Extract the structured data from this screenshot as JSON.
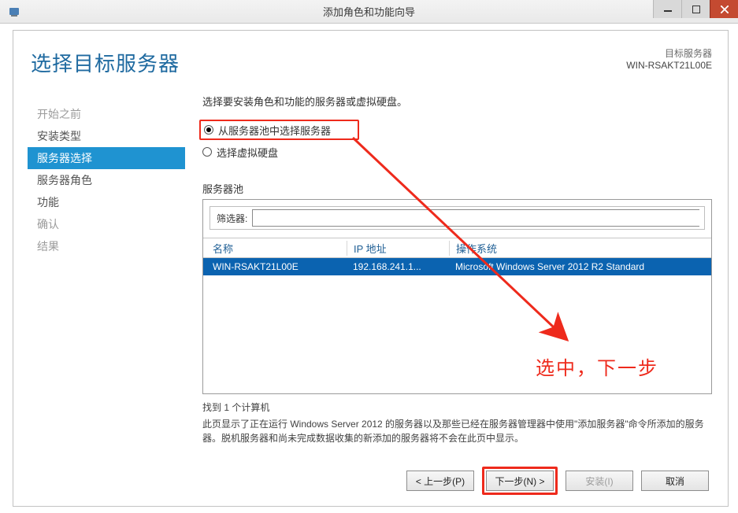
{
  "window": {
    "title": "添加角色和功能向导"
  },
  "header": {
    "heading": "选择目标服务器",
    "dest_label": "目标服务器",
    "dest_name": "WIN-RSAKT21L00E"
  },
  "sidebar": {
    "items": [
      {
        "label": "开始之前"
      },
      {
        "label": "安装类型"
      },
      {
        "label": "服务器选择"
      },
      {
        "label": "服务器角色"
      },
      {
        "label": "功能"
      },
      {
        "label": "确认"
      },
      {
        "label": "结果"
      }
    ]
  },
  "content": {
    "instruction": "选择要安装角色和功能的服务器或虚拟硬盘。",
    "radio_pool": "从服务器池中选择服务器",
    "radio_vhd": "选择虚拟硬盘",
    "pool_title": "服务器池",
    "filter_label": "筛选器:",
    "filter_value": "",
    "columns": {
      "name": "名称",
      "ip": "IP 地址",
      "os": "操作系统"
    },
    "rows": [
      {
        "name": "WIN-RSAKT21L00E",
        "ip": "192.168.241.1...",
        "os": "Microsoft Windows Server 2012 R2 Standard"
      }
    ],
    "found_text": "找到 1 个计算机",
    "description": "此页显示了正在运行 Windows Server 2012 的服务器以及那些已经在服务器管理器中使用\"添加服务器\"命令所添加的服务器。脱机服务器和尚未完成数据收集的新添加的服务器将不会在此页中显示。"
  },
  "buttons": {
    "prev": "< 上一步(P)",
    "next": "下一步(N) >",
    "install": "安装(I)",
    "cancel": "取消"
  },
  "annotation": {
    "text": "选中，下一步"
  }
}
